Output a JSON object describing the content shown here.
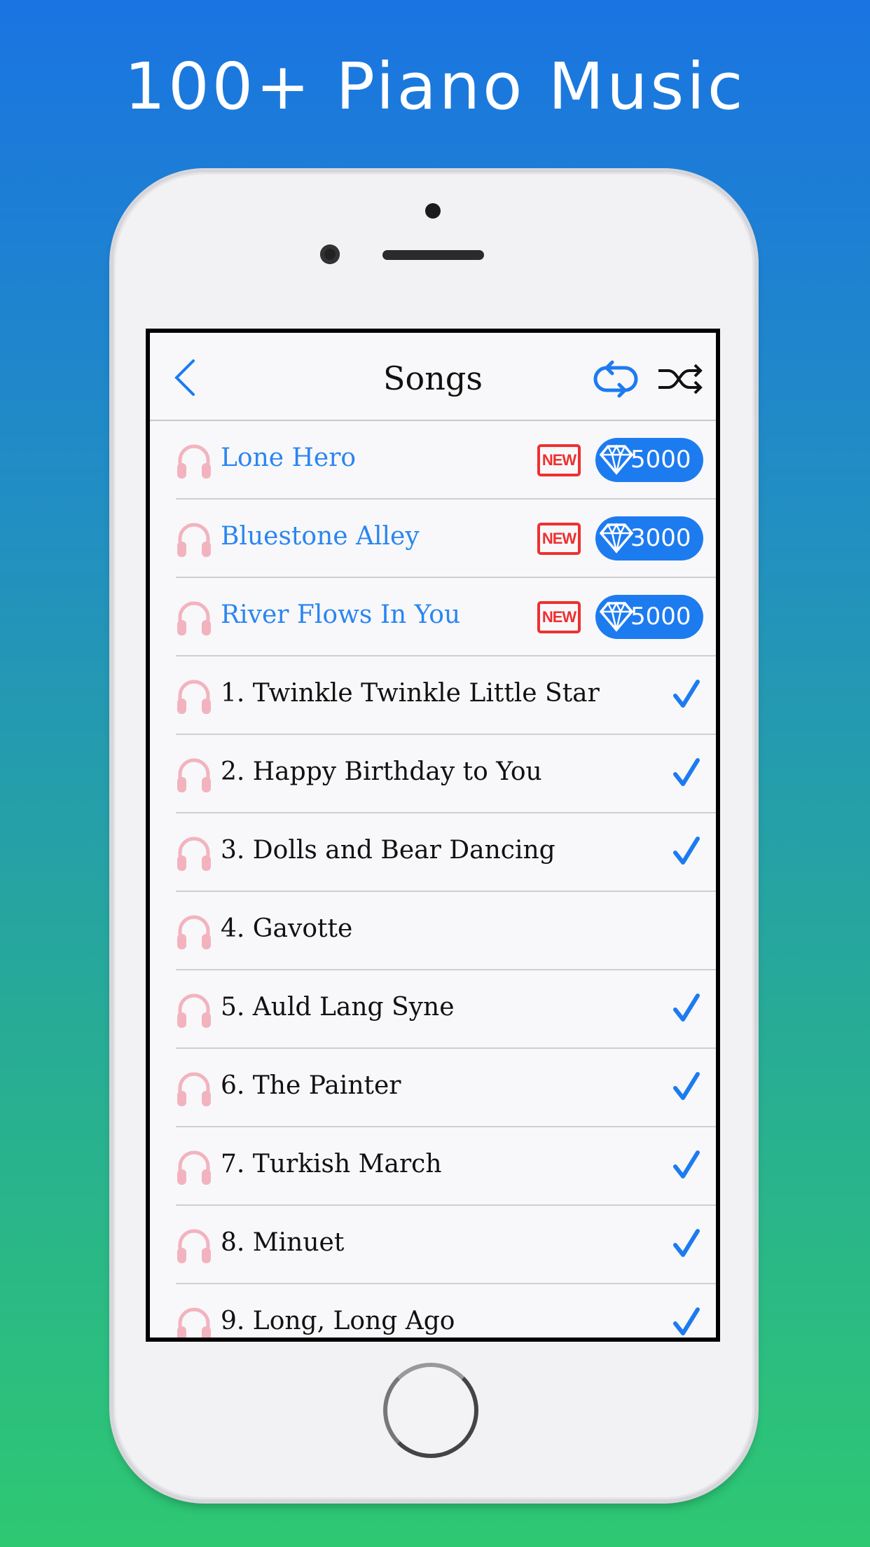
{
  "headline": "100+ Piano Music",
  "nav": {
    "title": "Songs",
    "back_icon": "chevron-left-icon",
    "repeat_icon": "repeat-icon",
    "shuffle_icon": "shuffle-icon"
  },
  "colors": {
    "accent": "#1d7bf0",
    "new_badge": "#ee3030",
    "headphones": "#f2b3bf",
    "bg_top": "#1a74e2",
    "bg_bottom": "#2ec872"
  },
  "songs": [
    {
      "title": "Lone Hero",
      "premium": true,
      "badge": "NEW",
      "price": "5000",
      "completed": false
    },
    {
      "title": "Bluestone Alley",
      "premium": true,
      "badge": "NEW",
      "price": "3000",
      "completed": false
    },
    {
      "title": "River Flows In You",
      "premium": true,
      "badge": "NEW",
      "price": "5000",
      "completed": false
    },
    {
      "title": "1. Twinkle Twinkle Little Star",
      "premium": false,
      "completed": true
    },
    {
      "title": "2. Happy Birthday to You",
      "premium": false,
      "completed": true
    },
    {
      "title": "3. Dolls and Bear Dancing",
      "premium": false,
      "completed": true
    },
    {
      "title": "4. Gavotte",
      "premium": false,
      "completed": false
    },
    {
      "title": "5. Auld Lang Syne",
      "premium": false,
      "completed": true
    },
    {
      "title": "6. The Painter",
      "premium": false,
      "completed": true
    },
    {
      "title": "7. Turkish March",
      "premium": false,
      "completed": true
    },
    {
      "title": "8. Minuet",
      "premium": false,
      "completed": true
    },
    {
      "title": "9. Long, Long Ago",
      "premium": false,
      "completed": true
    }
  ]
}
